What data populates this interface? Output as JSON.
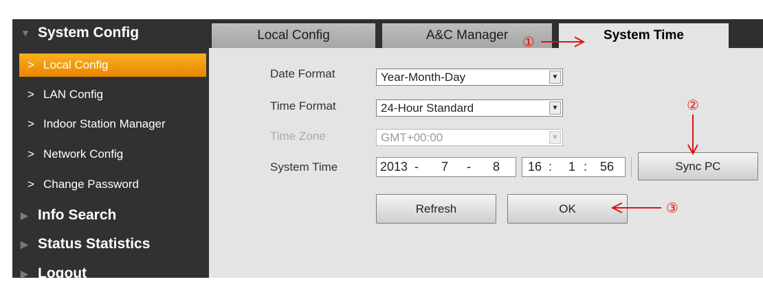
{
  "sidebar": {
    "system_config": "System Config",
    "items": [
      {
        "label": "Local Config",
        "active": true
      },
      {
        "label": "LAN Config"
      },
      {
        "label": "Indoor Station Manager"
      },
      {
        "label": "Network Config"
      },
      {
        "label": "Change Password"
      }
    ],
    "info_search": "Info Search",
    "status_statistics": "Status Statistics",
    "logout": "Logout"
  },
  "tabs": [
    {
      "label": "Local Config"
    },
    {
      "label": "A&C Manager"
    },
    {
      "label": "System Time",
      "selected": true
    }
  ],
  "form": {
    "date_format_label": "Date Format",
    "date_format_value": "Year-Month-Day",
    "time_format_label": "Time Format",
    "time_format_value": "24-Hour Standard",
    "time_zone_label": "Time Zone",
    "time_zone_value": "GMT+00:00",
    "system_time_label": "System Time",
    "date_year": "2013",
    "date_month": "7",
    "date_day": "8",
    "time_hour": "16",
    "time_minute": "1",
    "time_second": "56",
    "date_sep": "-",
    "time_sep": ":"
  },
  "buttons": {
    "sync_pc": "Sync PC",
    "refresh": "Refresh",
    "ok": "OK"
  },
  "annotations": {
    "step1": "①",
    "step2": "②",
    "step3": "③"
  },
  "colors": {
    "accent_orange": "#f29a10",
    "annotation_red": "#e01010",
    "sidebar_bg": "#313131",
    "content_bg": "#e4e4e4"
  },
  "icons": {
    "section_expanded": "triangle-down-icon",
    "section_collapsed": "triangle-right-icon",
    "item": "chevron-right-icon",
    "dropdown": "triangle-down-icon"
  }
}
